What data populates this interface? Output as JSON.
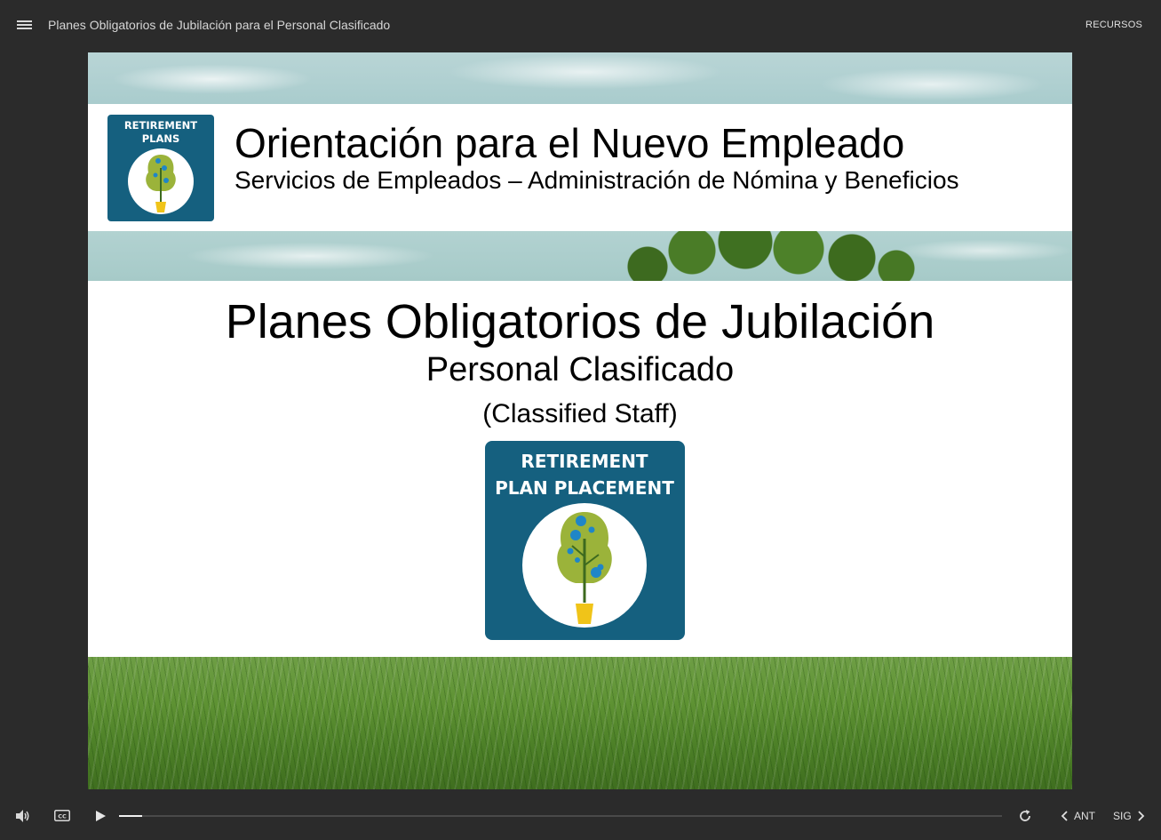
{
  "topbar": {
    "course_title": "Planes Obligatorios de Jubilación para el Personal Clasificado",
    "resources_label": "RECURSOS"
  },
  "slide": {
    "header_title": "Orientación para el Nuevo Empleado",
    "header_subtitle": "Servicios de Empleados – Administración de Nómina y Beneficios",
    "main_title": "Planes Obligatorios de Jubilación",
    "subtitle": "Personal Clasificado",
    "subtitle_english": "(Classified Staff)",
    "logo_small": {
      "line1": "RETIREMENT",
      "line2": "PLANS"
    },
    "logo_big": {
      "line1": "RETIREMENT",
      "line2": "PLAN PLACEMENT"
    }
  },
  "controls": {
    "prev_label": "ANT",
    "next_label": "SIG",
    "progress_fraction": 0.026
  },
  "icons": {
    "menu": "menu-icon",
    "volume": "volume-icon",
    "captions": "closed-captions-icon",
    "play": "play-icon",
    "replay": "replay-icon",
    "prev": "chevron-left-icon",
    "next": "chevron-right-icon"
  },
  "colors": {
    "background": "#2b2b2b",
    "badge_blue": "#15607f",
    "tree_green": "#9bb33a",
    "pot_yellow": "#f0c419",
    "coin_blue": "#1f86c7"
  }
}
